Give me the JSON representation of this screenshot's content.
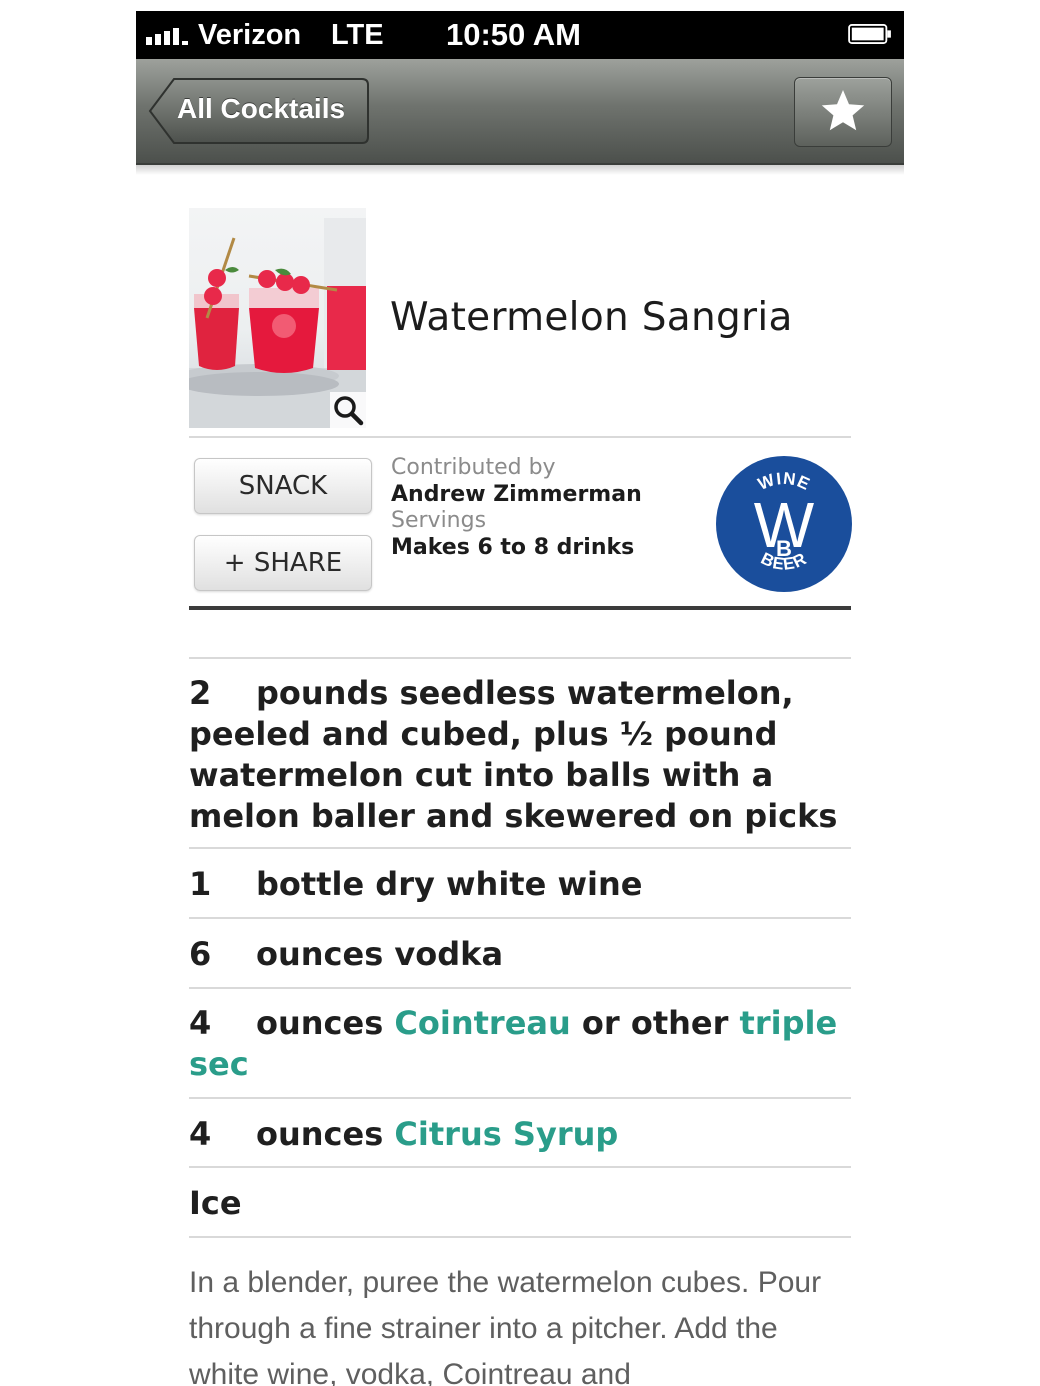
{
  "status_bar": {
    "carrier": "Verizon",
    "network": "LTE",
    "time": "10:50 AM"
  },
  "nav": {
    "back_label": "All Cocktails",
    "favorite_icon": "star-icon"
  },
  "recipe": {
    "title": "Watermelon Sangria",
    "buttons": {
      "snack": "SNACK",
      "share": "+ SHARE"
    },
    "contributed_label": "Contributed by",
    "contributor": "Andrew Zimmerman",
    "servings_label": "Servings",
    "servings": "Makes 6 to 8 drinks",
    "badge": {
      "top": "WINE",
      "letters": "W",
      "bottom_letter": "B",
      "bottom": "BEER",
      "color": "#1a4e9c"
    }
  },
  "ingredients": [
    {
      "qty": "2",
      "text": "pounds seedless watermelon,",
      "cont": "peeled and cubed, plus ½ pound watermelon cut into balls with a melon baller and skewered on picks"
    },
    {
      "qty": "1",
      "text": "bottle dry white wine"
    },
    {
      "qty": "6",
      "text": "ounces vodka"
    },
    {
      "qty": "4",
      "text_a": "ounces ",
      "link1": "Cointreau",
      "text_b": " or other ",
      "link2": "triple",
      "link3": "sec"
    },
    {
      "qty": "4",
      "text_a": "ounces ",
      "link1": "Citrus Syrup"
    },
    {
      "text": "Ice"
    }
  ],
  "directions": "In a blender, puree the watermelon cubes. Pour through a fine strainer into a pitcher. Add the white wine, vodka, Cointreau and",
  "colors": {
    "link": "#2a9d8a",
    "badge": "#1a4e9c"
  }
}
